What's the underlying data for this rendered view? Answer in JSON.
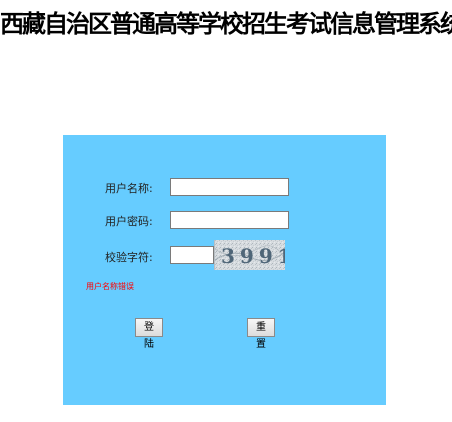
{
  "header": {
    "title": "西藏自治区普通高等学校招生考试信息管理系统"
  },
  "login_form": {
    "username_label": "用户名称:",
    "username_value": "",
    "password_label": "用户密码:",
    "password_value": "",
    "captcha_label": "校验字符:",
    "captcha_value": "",
    "captcha_code": "3991",
    "error_message": "用户名称错误",
    "login_button": "登陆",
    "reset_button": "重置"
  },
  "colors": {
    "panel_background": "#66ccff",
    "error_text": "#ff0000"
  }
}
